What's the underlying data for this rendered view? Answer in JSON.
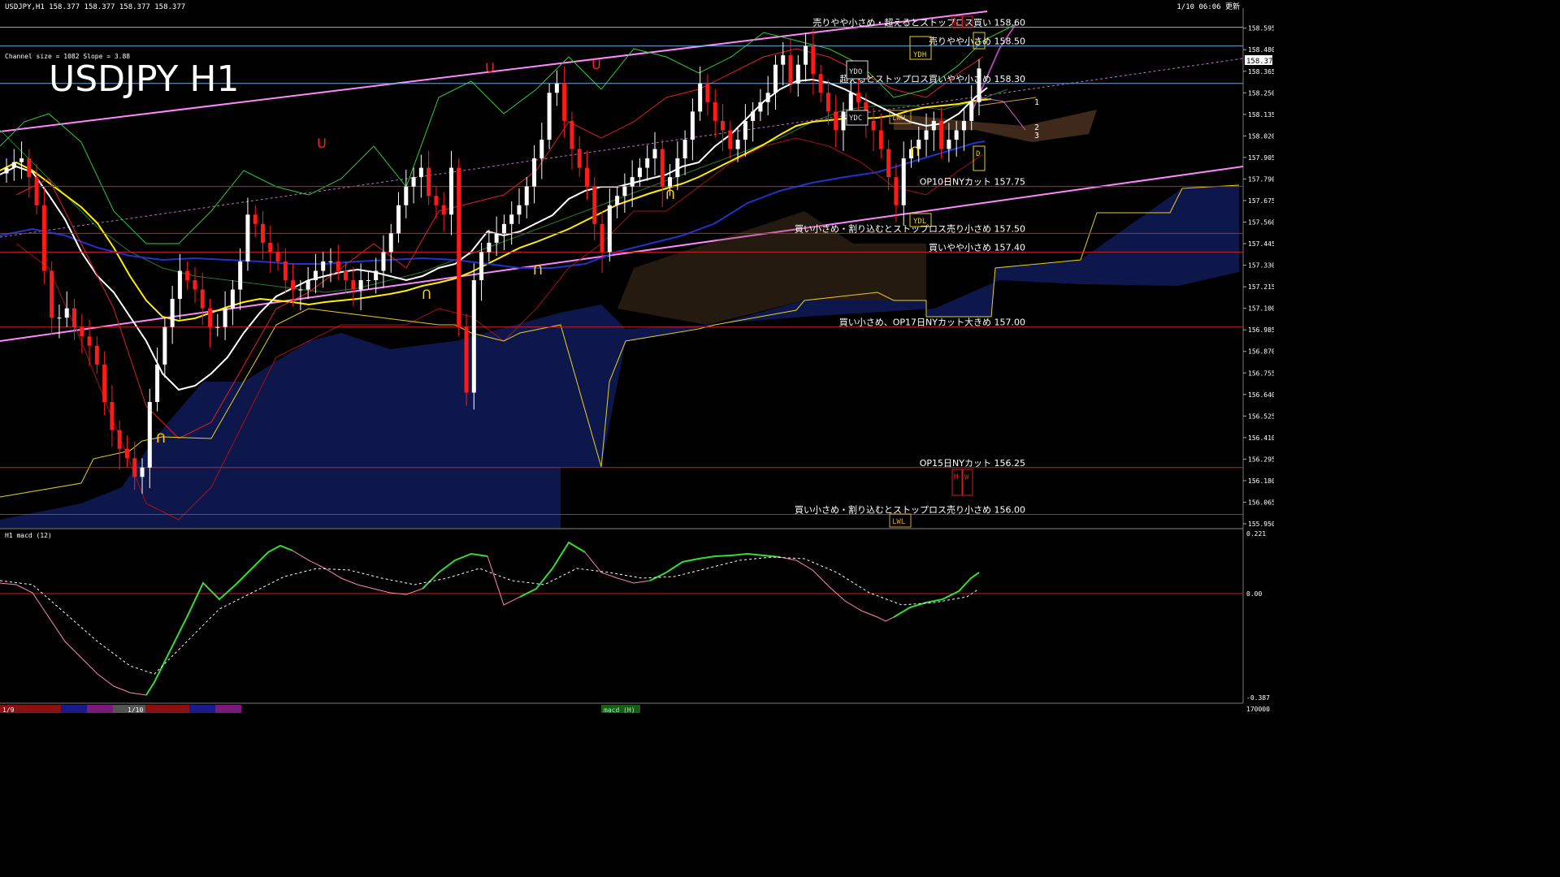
{
  "header": {
    "symbol_info": "USDJPY,H1  158.377 158.377 158.377 158.377",
    "updated": "1/10 06:06 更新",
    "channel_info": "Channel size = 1082 Slope = 3.88",
    "big_title": "USDJPY H1",
    "macd_title": "H1  macd (12)"
  },
  "price_axis": {
    "ticks": [
      "158.595",
      "158.480",
      "158.365",
      "158.250",
      "158.135",
      "158.020",
      "157.905",
      "157.790",
      "157.675",
      "157.560",
      "157.445",
      "157.330",
      "157.215",
      "157.100",
      "156.985",
      "156.870",
      "156.755",
      "156.640",
      "156.525",
      "156.410",
      "156.295",
      "156.180",
      "156.065",
      "155.950"
    ],
    "current_price": "158.377"
  },
  "macd_axis": {
    "top": "0.221",
    "zero": "0.00",
    "bottom": "-0.387",
    "footer": "170000"
  },
  "levels": [
    {
      "price": 158.6,
      "label": "売りやや小さめ・超えるとストップロス買い 158.60",
      "color": "#6fa8dc"
    },
    {
      "price": 158.5,
      "label": "売りやや小さめ 158.50",
      "color": "#6fa8dc"
    },
    {
      "price": 158.3,
      "label": "超えるとストップロス買いやや小さめ 158.30",
      "color": "#6fa8dc"
    },
    {
      "price": 157.75,
      "label": "OP10日NYカット 157.75",
      "color": "#cc2222"
    },
    {
      "price": 157.5,
      "label": "買い小さめ・割り込むとストップロス売り小さめ 157.50",
      "color": "#cc2222"
    },
    {
      "price": 157.4,
      "label": "買いやや小さめ 157.40",
      "color": "#cc2222"
    },
    {
      "price": 157.0,
      "label": "買い小さめ、OP17日NYカット大きめ 157.00",
      "color": "#cc2222"
    },
    {
      "price": 156.25,
      "label": "OP15日NYカット 156.25",
      "color": "#cc2222"
    },
    {
      "price": 156.0,
      "label": "買い小さめ・割り込むとストップロス売り小さめ 156.00",
      "color": "#cc2222"
    }
  ],
  "markers": {
    "ydh": "YDH",
    "ydo": "YDO",
    "ydc": "YDC",
    "ydl": "YDL",
    "lwh": "LWH",
    "lwl": "LWL",
    "m": "M",
    "w": "W",
    "d": "D",
    "n1": "1",
    "n2": "2",
    "n3": "3"
  },
  "bottom_bar": {
    "date1": "1/9",
    "date2": "1/10",
    "tab_label": "macd (H)"
  },
  "chart_data": {
    "type": "candlestick",
    "title": "USDJPY H1",
    "ylim": [
      155.95,
      158.65
    ],
    "close": [
      157.85,
      157.88,
      157.9,
      157.8,
      157.65,
      157.3,
      157.05,
      157.05,
      157.1,
      157.0,
      156.95,
      156.9,
      156.8,
      156.6,
      156.45,
      156.35,
      156.3,
      156.2,
      156.25,
      156.6,
      156.8,
      157.0,
      157.15,
      157.3,
      157.25,
      157.2,
      157.1,
      157.0,
      157.0,
      157.1,
      157.2,
      157.35,
      157.6,
      157.55,
      157.45,
      157.4,
      157.35,
      157.25,
      157.2,
      157.2,
      157.25,
      157.3,
      157.35,
      157.35,
      157.3,
      157.25,
      157.2,
      157.25,
      157.25,
      157.3,
      157.4,
      157.5,
      157.65,
      157.75,
      157.8,
      157.85,
      157.7,
      157.65,
      157.6,
      157.85,
      157.0,
      156.65,
      157.25,
      157.4,
      157.45,
      157.5,
      157.55,
      157.6,
      157.65,
      157.75,
      157.9,
      158.0,
      158.25,
      158.3,
      158.1,
      157.95,
      157.85,
      157.75,
      157.55,
      157.4,
      157.65,
      157.7,
      157.75,
      157.8,
      157.85,
      157.9,
      157.95,
      157.75,
      157.8,
      157.9,
      158.0,
      158.15,
      158.3,
      158.2,
      158.1,
      158.05,
      157.95,
      158.0,
      158.1,
      158.15,
      158.2,
      158.25,
      158.4,
      158.45,
      158.3,
      158.4,
      158.5,
      158.35,
      158.25,
      158.15,
      158.05,
      158.15,
      158.25,
      158.2,
      158.1,
      158.05,
      157.95,
      157.8,
      157.65,
      157.9,
      157.95,
      158.0,
      158.05,
      158.1,
      157.95,
      158.0,
      158.05,
      158.1,
      158.2,
      158.38
    ]
  }
}
